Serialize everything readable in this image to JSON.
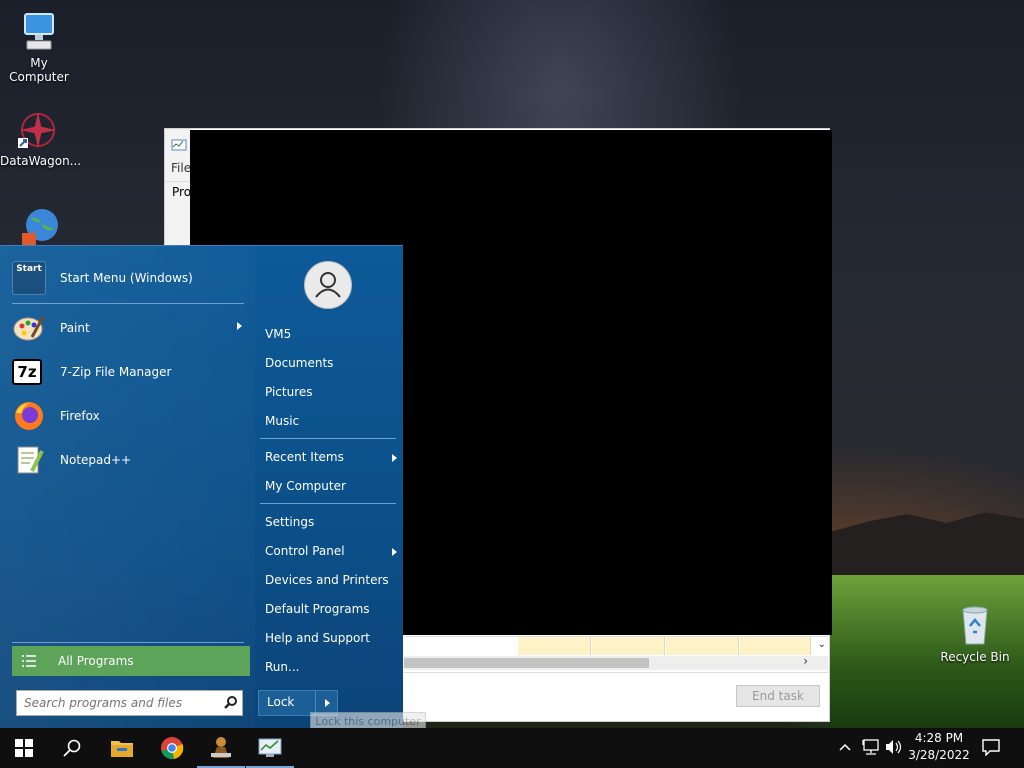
{
  "desktop": {
    "icons": [
      {
        "label": "My Computer",
        "icon": "computer-icon"
      },
      {
        "label": "DataWagon...",
        "icon": "datawagon-icon"
      },
      {
        "label": "",
        "icon": "globe-download-icon"
      },
      {
        "label": "Recycle Bin",
        "icon": "recycle-bin-icon"
      }
    ]
  },
  "task_window": {
    "menu_file": "File",
    "tab_processes": "Pro",
    "end_task": "End task"
  },
  "start_menu": {
    "pinned": [
      {
        "label": "Start Menu (Windows)",
        "icon": "start-menu-icon"
      }
    ],
    "recent": [
      {
        "label": "Paint",
        "icon": "paint-icon",
        "submenu": true
      },
      {
        "label": "7-Zip File Manager",
        "icon": "7zip-icon",
        "icon_text": "7z",
        "submenu": false
      },
      {
        "label": "Firefox",
        "icon": "firefox-icon",
        "submenu": false
      },
      {
        "label": "Notepad++",
        "icon": "notepadpp-icon",
        "submenu": false
      }
    ],
    "all_programs": "All Programs",
    "search_placeholder": "Search programs and files",
    "user_items": [
      "VM5",
      "Documents",
      "Pictures",
      "Music"
    ],
    "mid_items": [
      {
        "label": "Recent Items",
        "submenu": true
      },
      {
        "label": "My Computer",
        "submenu": false
      }
    ],
    "system_items": [
      {
        "label": "Settings",
        "submenu": false
      },
      {
        "label": "Control Panel",
        "submenu": true
      },
      {
        "label": "Devices and Printers",
        "submenu": false
      },
      {
        "label": "Default Programs",
        "submenu": false
      },
      {
        "label": "Help and Support",
        "submenu": false
      },
      {
        "label": "Run...",
        "submenu": false
      }
    ],
    "lock_label": "Lock",
    "lock_tooltip": "Lock this computer",
    "start_icon_text": "Start"
  },
  "taskbar": {
    "buttons": [
      "windows-start-icon",
      "search-icon",
      "file-explorer-icon",
      "chrome-icon",
      "app-icon",
      "task-manager-icon"
    ],
    "time": "4:28 PM",
    "date": "3/28/2022"
  },
  "colors": {
    "start_bg": "#0c4f88",
    "all_programs_bg": "#5da35a",
    "taskbar_bg": "#0f0f10"
  }
}
